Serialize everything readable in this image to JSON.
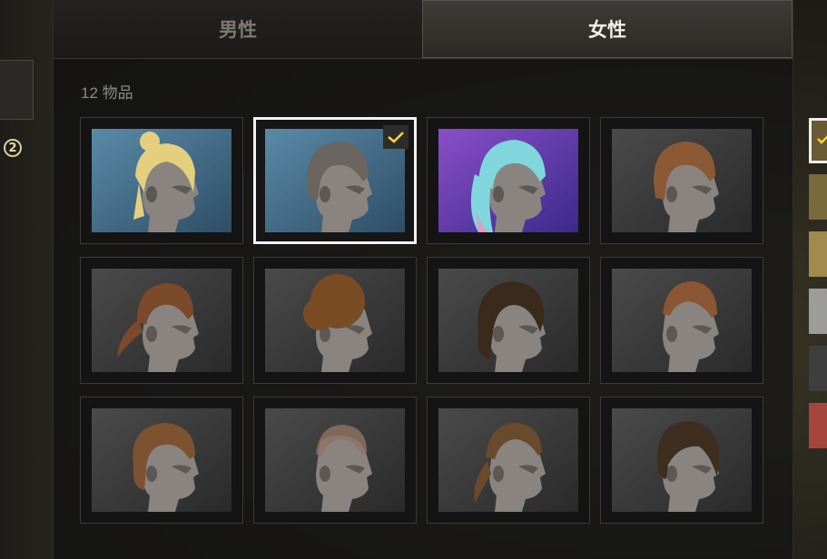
{
  "tabs": [
    {
      "label": "男性",
      "active": false
    },
    {
      "label": "女性",
      "active": true
    }
  ],
  "item_count_text": "12 物品",
  "step_badge": "2",
  "hair_items": [
    {
      "name": "blonde-bun-hair",
      "hair": "#e4cf7e",
      "style": "bun",
      "bg": "blue",
      "selected": false
    },
    {
      "name": "short-dark-bob-hair",
      "hair": "#6a655f",
      "style": "bob",
      "bg": "blue",
      "selected": true
    },
    {
      "name": "cyan-pink-pigtails-hair",
      "hair": "#7fd6dc",
      "style": "pigtails",
      "bg": "purple",
      "selected": false
    },
    {
      "name": "auburn-bob-hair",
      "hair": "#8b5a34",
      "style": "bob",
      "bg": "grey",
      "selected": false
    },
    {
      "name": "auburn-ponytail-hair",
      "hair": "#7a4a2a",
      "style": "ponytail",
      "bg": "grey",
      "selected": false
    },
    {
      "name": "afro-hair",
      "hair": "#7a4c24",
      "style": "afro",
      "bg": "grey",
      "selected": false
    },
    {
      "name": "dark-curly-hair",
      "hair": "#3a2a1c",
      "style": "curly",
      "bg": "grey",
      "selected": false
    },
    {
      "name": "undercut-hair",
      "hair": "#8a5634",
      "style": "undercut",
      "bg": "grey",
      "selected": false
    },
    {
      "name": "wavy-bob-hair",
      "hair": "#7c5230",
      "style": "wavy",
      "bg": "grey",
      "selected": false
    },
    {
      "name": "buzzcut-hair",
      "hair": "#8e7462",
      "style": "buzz",
      "bg": "grey",
      "selected": false
    },
    {
      "name": "slicked-ponytail-hair",
      "hair": "#6a4a2c",
      "style": "slicked",
      "bg": "grey",
      "selected": false
    },
    {
      "name": "side-swept-hair",
      "hair": "#3e2e20",
      "style": "sideswept",
      "bg": "grey",
      "selected": false
    }
  ],
  "colors": {
    "check": "#f5d33c",
    "skin": "#8a8480",
    "skin_shadow": "#5d5855"
  },
  "color_swatches": [
    {
      "color": "#6a5a34",
      "selected": true
    },
    {
      "color": "#7a6a3c",
      "selected": false
    },
    {
      "color": "#a08a4e",
      "selected": false
    },
    {
      "color": "#9c9d99",
      "selected": false
    },
    {
      "color": "#3e3f3d",
      "selected": false
    },
    {
      "color": "#a5453e",
      "selected": false
    }
  ]
}
